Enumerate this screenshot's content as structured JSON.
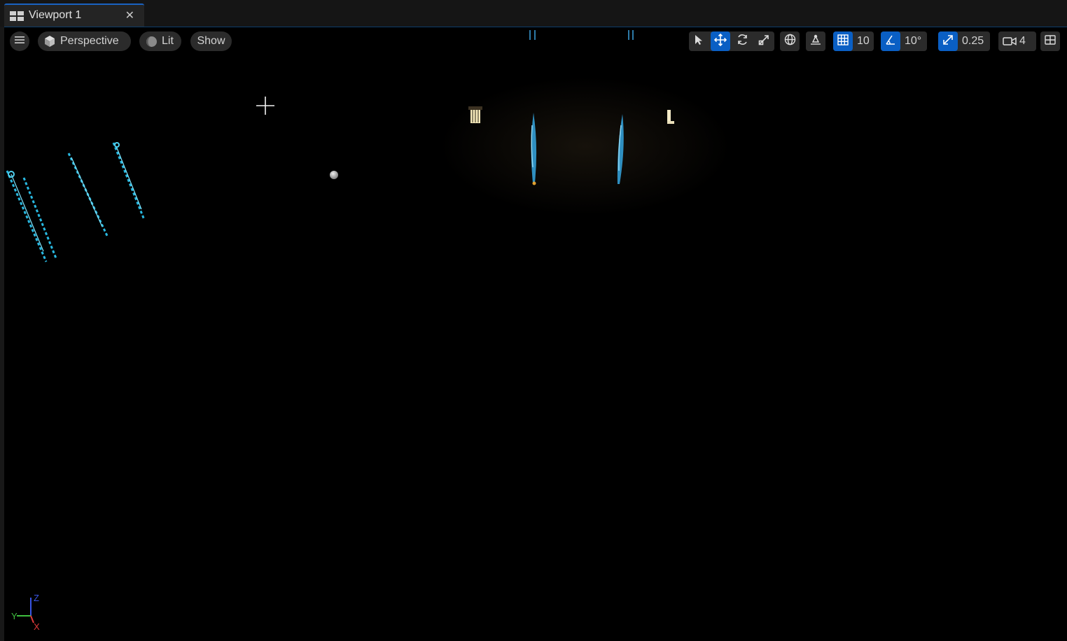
{
  "tab": {
    "title": "Viewport 1",
    "close_glyph": "✕",
    "icon": "viewport-grid-icon"
  },
  "toolbar": {
    "menu_icon": "hamburger-menu-icon",
    "perspective_label": "Perspective",
    "lit_label": "Lit",
    "show_label": "Show",
    "grid_snap_value": "10",
    "rotation_snap_value": "10°",
    "scale_snap_value": "0.25",
    "camera_speed_value": "4",
    "active_transform": "translate",
    "accent_color": "#0a5fc4"
  },
  "axis_gizmo": {
    "y_label": "Y",
    "z_label": "Z",
    "x_label": "X",
    "y_color": "#3fbf3f",
    "z_color": "#3a55e6",
    "x_color": "#e03a3a"
  }
}
